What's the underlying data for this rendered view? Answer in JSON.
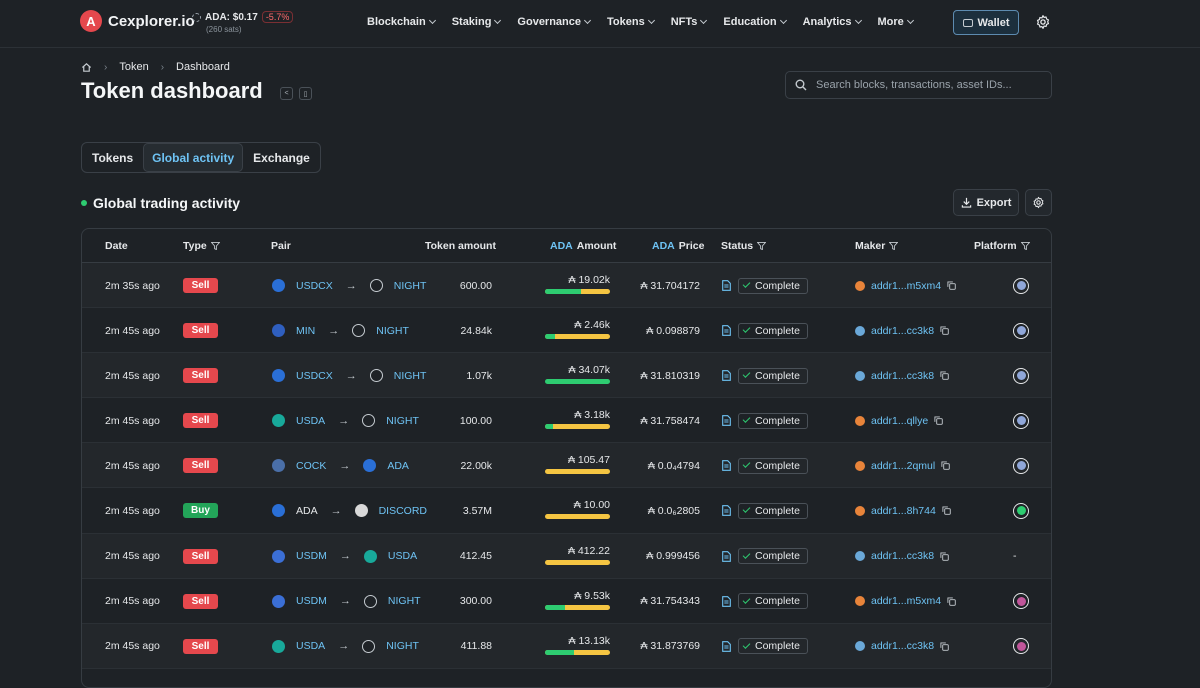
{
  "nav": {
    "logo_text": "Cexplorer.io",
    "ada_price": "ADA: $0.17",
    "ada_change": "-5.7%",
    "ada_sats": "(260 sats)",
    "menu": [
      "Blockchain",
      "Staking",
      "Governance",
      "Tokens",
      "NFTs",
      "Education",
      "Analytics",
      "More"
    ],
    "wallet_label": "Wallet"
  },
  "breadcrumb": [
    "Token",
    "Dashboard"
  ],
  "page_title": "Token dashboard",
  "search": {
    "placeholder": "Search blocks, transactions, asset IDs..."
  },
  "tabs": [
    {
      "label": "Tokens",
      "active": false
    },
    {
      "label": "Global activity",
      "active": true
    },
    {
      "label": "Exchange",
      "active": false
    }
  ],
  "section_title": "Global trading activity",
  "export_label": "Export",
  "table": {
    "headers": {
      "date": "Date",
      "type": "Type",
      "pair": "Pair",
      "token_amount": "Token amount",
      "ada_amount_prefix": "ADA",
      "ada_amount_suffix": "Amount",
      "ada_price_prefix": "ADA",
      "ada_price_suffix": "Price",
      "status": "Status",
      "maker": "Maker",
      "platform": "Platform"
    },
    "rows": [
      {
        "date": "2m 35s ago",
        "type": "Sell",
        "from": "USDCX",
        "from_color": "#2a6fd6",
        "from_link": true,
        "to": "NIGHT",
        "to_color": "#1e2226",
        "token_amount": "600.00",
        "ada_amount": "₳ 19.02k",
        "ada_green": 0.55,
        "ada_price": "₳ 31.704172",
        "status": "Complete",
        "maker": "addr1...m5xm4",
        "maker_color": "#e8843a",
        "platform_color": "#8fa6d8"
      },
      {
        "date": "2m 45s ago",
        "type": "Sell",
        "from": "MIN",
        "from_color": "#2f5fbf",
        "from_link": true,
        "to": "NIGHT",
        "to_color": "#1e2226",
        "token_amount": "24.84k",
        "ada_amount": "₳ 2.46k",
        "ada_green": 0.15,
        "ada_price": "₳ 0.098879",
        "status": "Complete",
        "maker": "addr1...cc3k8",
        "maker_color": "#6aa8d8",
        "platform_color": "#8fa6d8"
      },
      {
        "date": "2m 45s ago",
        "type": "Sell",
        "from": "USDCX",
        "from_color": "#2a6fd6",
        "from_link": true,
        "to": "NIGHT",
        "to_color": "#1e2226",
        "token_amount": "1.07k",
        "ada_amount": "₳ 34.07k",
        "ada_green": 1.0,
        "ada_price": "₳ 31.810319",
        "status": "Complete",
        "maker": "addr1...cc3k8",
        "maker_color": "#6aa8d8",
        "platform_color": "#8fa6d8"
      },
      {
        "date": "2m 45s ago",
        "type": "Sell",
        "from": "USDA",
        "from_color": "#18a99a",
        "from_link": true,
        "to": "NIGHT",
        "to_color": "#1e2226",
        "token_amount": "100.00",
        "ada_amount": "₳ 3.18k",
        "ada_green": 0.12,
        "ada_price": "₳ 31.758474",
        "status": "Complete",
        "maker": "addr1...qllye",
        "maker_color": "#e8843a",
        "platform_color": "#8fa6d8"
      },
      {
        "date": "2m 45s ago",
        "type": "Sell",
        "from": "COCK",
        "from_color": "#4a6fa8",
        "from_link": true,
        "to": "ADA",
        "to_color": "#2a6fd6",
        "token_amount": "22.00k",
        "ada_amount": "₳ 105.47",
        "ada_green": 0.0,
        "ada_price": "₳ 0.0₄4794",
        "status": "Complete",
        "maker": "addr1...2qmul",
        "maker_color": "#e8843a",
        "platform_color": "#8fa6d8"
      },
      {
        "date": "2m 45s ago",
        "type": "Buy",
        "from": "ADA",
        "from_color": "#2a6fd6",
        "from_link": false,
        "to": "DISCORD",
        "to_color": "#d9d9d9",
        "token_amount": "3.57M",
        "ada_amount": "₳ 10.00",
        "ada_green": 0.0,
        "ada_price": "₳ 0.0₆2805",
        "status": "Complete",
        "maker": "addr1...8h744",
        "maker_color": "#e8843a",
        "platform_color": "#2ecc71"
      },
      {
        "date": "2m 45s ago",
        "type": "Sell",
        "from": "USDM",
        "from_color": "#3b6fd6",
        "from_link": true,
        "to": "USDA",
        "to_color": "#18a99a",
        "token_amount": "412.45",
        "ada_amount": "₳ 412.22",
        "ada_green": 0.0,
        "ada_price": "₳ 0.999456",
        "status": "Complete",
        "maker": "addr1...cc3k8",
        "maker_color": "#6aa8d8",
        "platform": "-",
        "platform_color": ""
      },
      {
        "date": "2m 45s ago",
        "type": "Sell",
        "from": "USDM",
        "from_color": "#3b6fd6",
        "from_link": true,
        "to": "NIGHT",
        "to_color": "#1e2226",
        "token_amount": "300.00",
        "ada_amount": "₳ 9.53k",
        "ada_green": 0.3,
        "ada_price": "₳ 31.754343",
        "status": "Complete",
        "maker": "addr1...m5xm4",
        "maker_color": "#e8843a",
        "platform_color": "#c0569a"
      },
      {
        "date": "2m 45s ago",
        "type": "Sell",
        "from": "USDA",
        "from_color": "#18a99a",
        "from_link": true,
        "to": "NIGHT",
        "to_color": "#1e2226",
        "token_amount": "411.88",
        "ada_amount": "₳ 13.13k",
        "ada_green": 0.45,
        "ada_price": "₳ 31.873769",
        "status": "Complete",
        "maker": "addr1...cc3k8",
        "maker_color": "#6aa8d8",
        "platform_color": "#c0569a"
      }
    ]
  }
}
